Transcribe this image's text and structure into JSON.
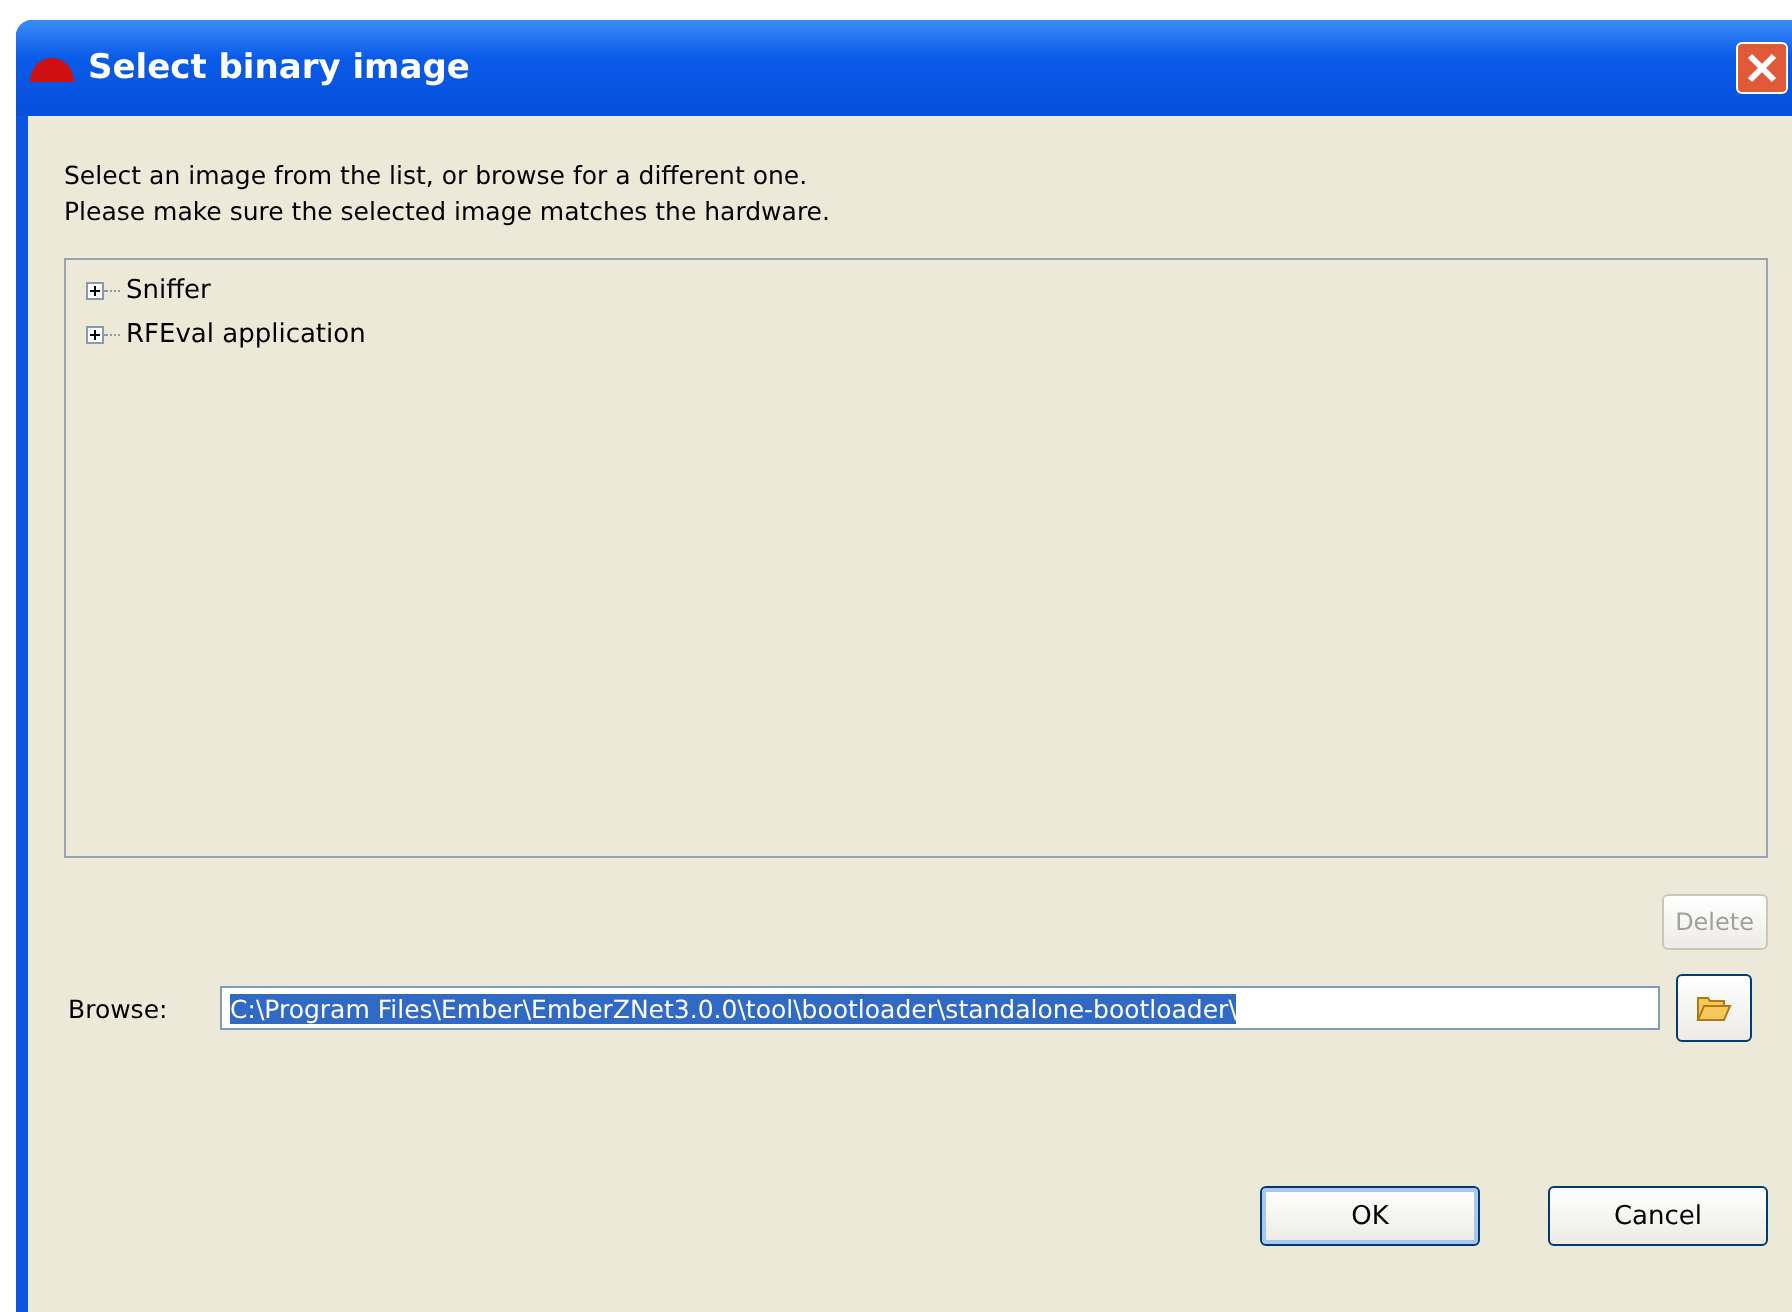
{
  "window": {
    "title": "Select binary image"
  },
  "instructions": [
    "Select an image from the list, or browse for a different one.",
    "Please make sure the selected image matches the hardware."
  ],
  "tree": {
    "items": [
      {
        "label": "Sniffer",
        "expanded": false
      },
      {
        "label": "RFEval application",
        "expanded": false
      }
    ]
  },
  "delete_button": {
    "label": "Delete",
    "disabled": true
  },
  "browse": {
    "label": "Browse:",
    "value": "C:\\Program Files\\Ember\\EmberZNet3.0.0\\tool\\bootloader\\standalone-bootloader\\",
    "selected": true
  },
  "buttons": [
    {
      "label": "OK",
      "default": true
    },
    {
      "label": "Cancel",
      "default": false
    }
  ]
}
